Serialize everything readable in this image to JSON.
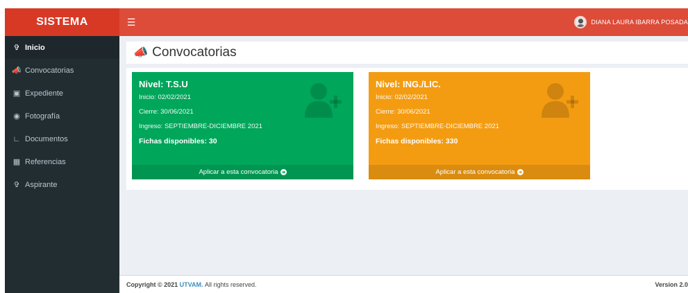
{
  "brand": {
    "logo_text": "SISTEMA"
  },
  "navbar": {
    "toggle_icon": "hamburger-icon",
    "user_name": "DIANA LAURA IBARRA POSADA"
  },
  "sidebar": {
    "items": [
      {
        "label": "Inicio",
        "icon": "pin-icon",
        "active": true
      },
      {
        "label": "Convocatorias",
        "icon": "megaphone-icon"
      },
      {
        "label": "Expediente",
        "icon": "drive-icon"
      },
      {
        "label": "Fotografía",
        "icon": "camera-icon"
      },
      {
        "label": "Documentos",
        "icon": "area-chart-icon"
      },
      {
        "label": "Referencias",
        "icon": "grid-icon"
      },
      {
        "label": "Aspirante",
        "icon": "pin-icon"
      }
    ]
  },
  "page": {
    "title": "Convocatorias"
  },
  "cards": [
    {
      "title": "Nivel: T.S.U",
      "inicio": "Inicio: 02/02/2021",
      "cierre": "Cierre: 30/06/2021",
      "ingreso": "Ingreso: SEPTIEMBRE-DICIEMBRE 2021",
      "fichas": "Fichas disponibles: 30",
      "action": "Aplicar a esta convocatoria",
      "color": "#00a65a"
    },
    {
      "title": "Nivel: ING./LIC.",
      "inicio": "Inicio: 02/02/2021",
      "cierre": "Cierre: 30/06/2021",
      "ingreso": "Ingreso: SEPTIEMBRE-DICIEMBRE 2021",
      "fichas": "Fichas disponibles: 330",
      "action": "Aplicar a esta convocatoria",
      "color": "#f39c12"
    }
  ],
  "footer": {
    "copyright_prefix": "Copyright © 2021",
    "org": "UTVAM.",
    "rights": "All rights reserved.",
    "version": "Version 2.0"
  },
  "colors": {
    "navbar": "#dd4b39",
    "logo": "#d73925",
    "sidebar": "#222d32",
    "link": "#3c8dbc"
  }
}
